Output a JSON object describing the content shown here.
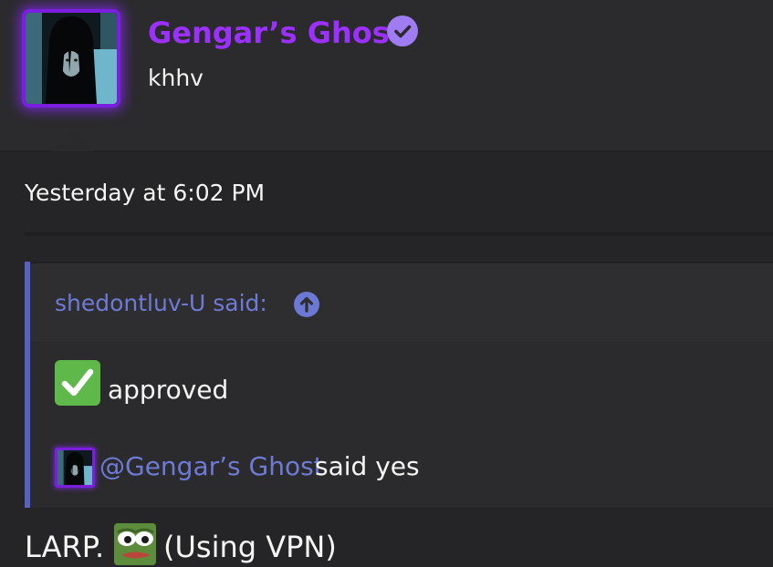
{
  "user": {
    "name": "Gengar’s Ghost",
    "status": "khhv",
    "avatar_icon": "ghost-girl-avatar",
    "verified_icon": "check-badge-icon",
    "name_color": "#9b30ff",
    "avatar_glow_color": "#7a1fe0"
  },
  "post": {
    "timestamp": "Yesterday at 6:02 PM",
    "quote": {
      "author_label": "shedontluv-U said:",
      "jump_icon": "arrow-up-circle-icon",
      "accent_color": "#5860c4",
      "line1": {
        "emoji": "white-check-mark-icon",
        "text": "approved"
      },
      "line2": {
        "mention": "@Gengar’s Ghost",
        "text": "said yes"
      }
    },
    "body": {
      "lead": "LARP.",
      "emoji": "pepe-frog-emoji",
      "tail": "(Using VPN)"
    }
  }
}
